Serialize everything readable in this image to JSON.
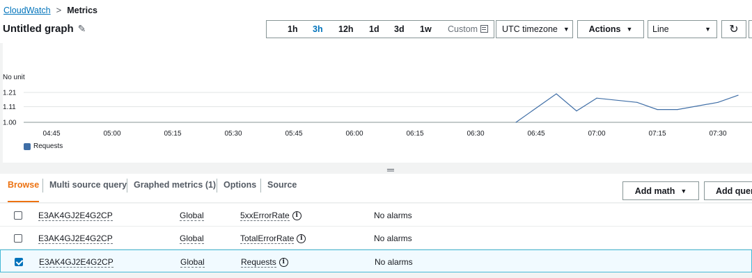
{
  "breadcrumb": {
    "root": "CloudWatch",
    "separator": ">",
    "current": "Metrics"
  },
  "graph": {
    "title": "Untitled graph",
    "edit_icon": "pencil-icon"
  },
  "time_range": {
    "options": [
      "1h",
      "3h",
      "12h",
      "1d",
      "3d",
      "1w"
    ],
    "active": "3h",
    "custom_label": "Custom",
    "custom_icon": "calendar-icon"
  },
  "controls": {
    "timezone": "UTC timezone",
    "actions": "Actions",
    "chart_type": "Line",
    "refresh_icon": "refresh-icon"
  },
  "colors": {
    "series": "#3f6ea6",
    "accent": "#ec7211",
    "link": "#0073bb"
  },
  "chart_data": {
    "type": "line",
    "ylabel": "No unit",
    "y_ticks": [
      "1.21",
      "1.11",
      "1.00"
    ],
    "ylim": [
      1.0,
      1.21
    ],
    "x_ticks": [
      "04:45",
      "05:00",
      "05:15",
      "05:30",
      "05:45",
      "06:00",
      "06:15",
      "06:30",
      "06:45",
      "07:00",
      "07:15",
      "07:30"
    ],
    "series": [
      {
        "name": "Requests",
        "x": [
          "06:40",
          "06:50",
          "06:55",
          "07:00",
          "07:10",
          "07:15",
          "07:20",
          "07:30",
          "07:35"
        ],
        "values": [
          1.0,
          1.2,
          1.08,
          1.17,
          1.14,
          1.09,
          1.09,
          1.14,
          1.19
        ]
      }
    ],
    "grid": true,
    "legend": "bottom-left"
  },
  "tabs": [
    {
      "label": "Browse",
      "active": true
    },
    {
      "label": "Multi source query",
      "active": false
    },
    {
      "label": "Graphed metrics (1)",
      "active": false
    },
    {
      "label": "Options",
      "active": false
    },
    {
      "label": "Source",
      "active": false
    }
  ],
  "buttons": {
    "add_math": "Add math",
    "add_query": "Add query"
  },
  "metrics": [
    {
      "distribution": "E3AK4GJ2E4G2CP",
      "region": "Global",
      "metric": "5xxErrorRate",
      "alarms": "No alarms",
      "checked": false
    },
    {
      "distribution": "E3AK4GJ2E4G2CP",
      "region": "Global",
      "metric": "TotalErrorRate",
      "alarms": "No alarms",
      "checked": false
    },
    {
      "distribution": "E3AK4GJ2E4G2CP",
      "region": "Global",
      "metric": "Requests",
      "alarms": "No alarms",
      "checked": true
    }
  ]
}
